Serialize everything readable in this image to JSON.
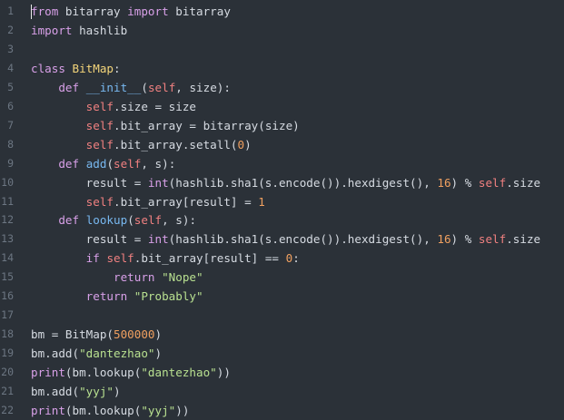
{
  "editor": {
    "lines": [
      {
        "n": "1",
        "tokens": [
          [
            "kw",
            "from"
          ],
          [
            "p",
            " bitarray "
          ],
          [
            "kw",
            "import"
          ],
          [
            "p",
            " bitarray"
          ]
        ]
      },
      {
        "n": "2",
        "tokens": [
          [
            "kw",
            "import"
          ],
          [
            "p",
            " hashlib"
          ]
        ]
      },
      {
        "n": "3",
        "tokens": []
      },
      {
        "n": "4",
        "tokens": [
          [
            "kw",
            "class"
          ],
          [
            "p",
            " "
          ],
          [
            "cls",
            "BitMap"
          ],
          [
            "p",
            ":"
          ]
        ]
      },
      {
        "n": "5",
        "tokens": [
          [
            "p",
            "    "
          ],
          [
            "kw",
            "def"
          ],
          [
            "p",
            " "
          ],
          [
            "fn",
            "__init__"
          ],
          [
            "p",
            "("
          ],
          [
            "self",
            "self"
          ],
          [
            "p",
            ", size):"
          ]
        ]
      },
      {
        "n": "6",
        "tokens": [
          [
            "p",
            "        "
          ],
          [
            "self",
            "self"
          ],
          [
            "p",
            ".size = size"
          ]
        ]
      },
      {
        "n": "7",
        "tokens": [
          [
            "p",
            "        "
          ],
          [
            "self",
            "self"
          ],
          [
            "p",
            ".bit_array = bitarray(size)"
          ]
        ]
      },
      {
        "n": "8",
        "tokens": [
          [
            "p",
            "        "
          ],
          [
            "self",
            "self"
          ],
          [
            "p",
            ".bit_array.setall("
          ],
          [
            "num",
            "0"
          ],
          [
            "p",
            ")"
          ]
        ]
      },
      {
        "n": "9",
        "tokens": [
          [
            "p",
            "    "
          ],
          [
            "kw",
            "def"
          ],
          [
            "p",
            " "
          ],
          [
            "fn",
            "add"
          ],
          [
            "p",
            "("
          ],
          [
            "self",
            "self"
          ],
          [
            "p",
            ", s):"
          ]
        ]
      },
      {
        "n": "10",
        "tokens": [
          [
            "p",
            "        result = "
          ],
          [
            "bi",
            "int"
          ],
          [
            "p",
            "(hashlib.sha1(s.encode()).hexdigest(), "
          ],
          [
            "num",
            "16"
          ],
          [
            "p",
            ") % "
          ],
          [
            "self",
            "self"
          ],
          [
            "p",
            ".size"
          ]
        ]
      },
      {
        "n": "11",
        "tokens": [
          [
            "p",
            "        "
          ],
          [
            "self",
            "self"
          ],
          [
            "p",
            ".bit_array[result] = "
          ],
          [
            "num",
            "1"
          ]
        ]
      },
      {
        "n": "12",
        "tokens": [
          [
            "p",
            "    "
          ],
          [
            "kw",
            "def"
          ],
          [
            "p",
            " "
          ],
          [
            "fn",
            "lookup"
          ],
          [
            "p",
            "("
          ],
          [
            "self",
            "self"
          ],
          [
            "p",
            ", s):"
          ]
        ]
      },
      {
        "n": "13",
        "tokens": [
          [
            "p",
            "        result = "
          ],
          [
            "bi",
            "int"
          ],
          [
            "p",
            "(hashlib.sha1(s.encode()).hexdigest(), "
          ],
          [
            "num",
            "16"
          ],
          [
            "p",
            ") % "
          ],
          [
            "self",
            "self"
          ],
          [
            "p",
            ".size"
          ]
        ]
      },
      {
        "n": "14",
        "tokens": [
          [
            "p",
            "        "
          ],
          [
            "kw",
            "if"
          ],
          [
            "p",
            " "
          ],
          [
            "self",
            "self"
          ],
          [
            "p",
            ".bit_array[result] == "
          ],
          [
            "num",
            "0"
          ],
          [
            "p",
            ":"
          ]
        ]
      },
      {
        "n": "15",
        "tokens": [
          [
            "p",
            "            "
          ],
          [
            "kw",
            "return"
          ],
          [
            "p",
            " "
          ],
          [
            "str",
            "\"Nope\""
          ]
        ]
      },
      {
        "n": "16",
        "tokens": [
          [
            "p",
            "        "
          ],
          [
            "kw",
            "return"
          ],
          [
            "p",
            " "
          ],
          [
            "str",
            "\"Probably\""
          ]
        ]
      },
      {
        "n": "17",
        "tokens": []
      },
      {
        "n": "18",
        "tokens": [
          [
            "p",
            "bm = BitMap("
          ],
          [
            "num",
            "500000"
          ],
          [
            "p",
            ")"
          ]
        ]
      },
      {
        "n": "19",
        "tokens": [
          [
            "p",
            "bm.add("
          ],
          [
            "str",
            "\"dantezhao\""
          ],
          [
            "p",
            ")"
          ]
        ]
      },
      {
        "n": "20",
        "tokens": [
          [
            "bi",
            "print"
          ],
          [
            "p",
            "(bm.lookup("
          ],
          [
            "str",
            "\"dantezhao\""
          ],
          [
            "p",
            "))"
          ]
        ]
      },
      {
        "n": "21",
        "tokens": [
          [
            "p",
            "bm.add("
          ],
          [
            "str",
            "\"yyj\""
          ],
          [
            "p",
            ")"
          ]
        ]
      },
      {
        "n": "22",
        "tokens": [
          [
            "bi",
            "print"
          ],
          [
            "p",
            "(bm.lookup("
          ],
          [
            "str",
            "\"yyj\""
          ],
          [
            "p",
            "))"
          ]
        ]
      }
    ]
  }
}
